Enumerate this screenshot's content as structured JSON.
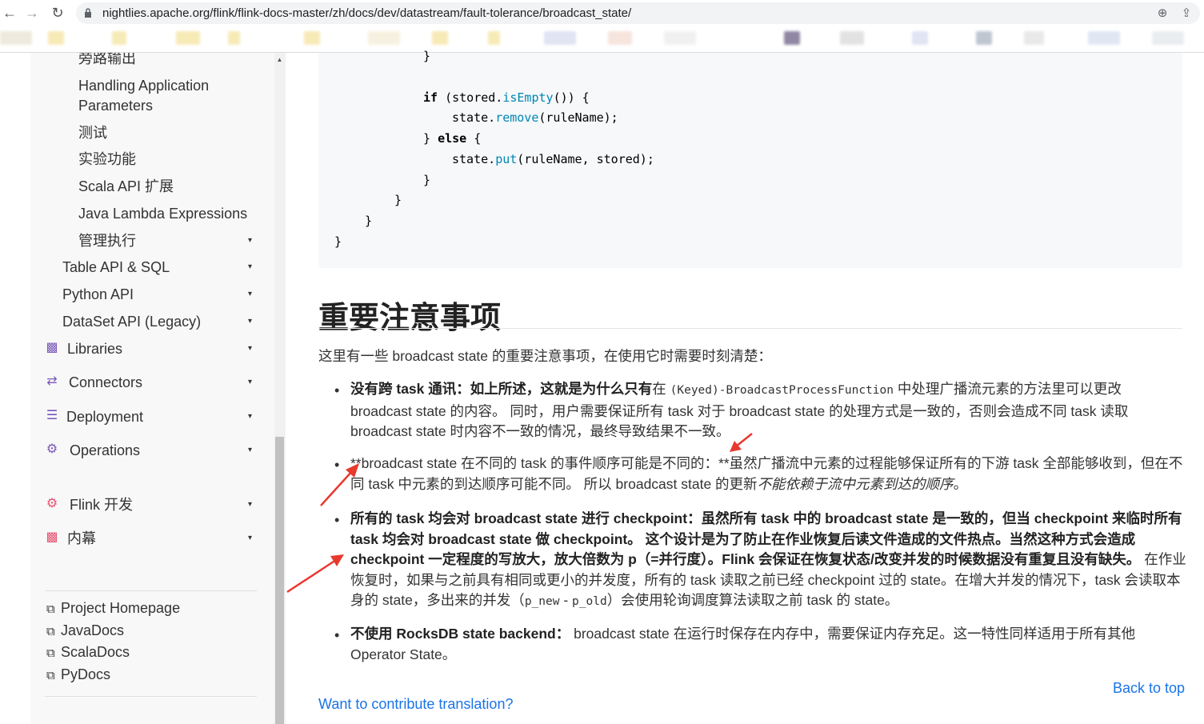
{
  "browser": {
    "url": "nightlies.apache.org/flink/flink-docs-master/zh/docs/dev/datastream/fault-tolerance/broadcast_state/",
    "back_icon": "←",
    "forward_icon": "→",
    "reload_icon": "↻",
    "zoom_icon": "⊕",
    "share_icon": "⇪"
  },
  "sidebar": {
    "top_items": [
      "旁路输出",
      "Handling Application",
      "Parameters",
      "测试",
      "实验功能",
      "Scala API 扩展",
      "Java Lambda Expressions",
      "管理执行"
    ],
    "sub_sections": [
      "Table API & SQL",
      "Python API",
      "DataSet API (Legacy)"
    ],
    "sections": [
      {
        "label": "Libraries",
        "icon": "book-icon"
      },
      {
        "label": "Connectors",
        "icon": "shuffle-icon"
      },
      {
        "label": "Deployment",
        "icon": "sliders-icon"
      },
      {
        "label": "Operations",
        "icon": "cogs-icon"
      },
      {
        "label": "Flink 开发",
        "icon": "cogs-icon"
      },
      {
        "label": "内幕",
        "icon": "book-icon"
      }
    ],
    "caret": "▾",
    "external_links": [
      "Project Homepage",
      "JavaDocs",
      "ScalaDocs",
      "PyDocs"
    ]
  },
  "code": {
    "line1": "}",
    "line2_kw": "if",
    "line2_a": " (stored.",
    "line2_fn": "isEmpty",
    "line2_b": "()) {",
    "line3_a": "state.",
    "line3_fn": "remove",
    "line3_b": "(ruleName);",
    "line4_a": "} ",
    "line4_kw": "else",
    "line4_b": " {",
    "line5_a": "state.",
    "line5_fn": "put",
    "line5_b": "(ruleName, stored);",
    "line6": "}",
    "line7": "}",
    "line8": "}",
    "line9": "}"
  },
  "content": {
    "heading": "重要注意事项",
    "intro": "这里有一些 broadcast state 的重要注意事项，在使用它时需要时刻清楚：",
    "items": [
      {
        "bold": "没有跨 task 通讯：如上所述，这就是为什么只有",
        "t1": "在 ",
        "code": "(Keyed)-BroadcastProcessFunction",
        "t2": " 中处理广播流元素的方法里可以更改 broadcast state 的内容。 同时，用户需要保证所有 task 对于 broadcast state 的处理方式是一致的，否则会造成不同 task 读取 broadcast state 时内容不一致的情况，最终导致结果不一致。"
      },
      {
        "t1": "**broadcast state 在不同的 task 的事件顺序可能是不同的：**虽然广播流中元素的过程能够保证所有的下游 task 全部能够收到，但在不同 task 中元素的到达顺序可能不同。 所以 broadcast state 的更新",
        "italic": "不能依赖于流中元素到达的顺序",
        "t2": "。"
      },
      {
        "bold": "所有的 task 均会对 broadcast state 进行 checkpoint：虽然所有 task 中的 broadcast state 是一致的，但当 checkpoint 来临时所有 task 均会对 broadcast state 做 checkpoint。 这个设计是为了防止在作业恢复后读文件造成的文件热点。当然这种方式会造成 checkpoint 一定程度的写放大，放大倍数为 p（=并行度）。Flink 会保证在恢复状态/改变并发的时候数据没有重复且没有缺失。",
        "t1": " 在作业恢复时，如果与之前具有相同或更小的并发度，所有的 task 读取之前已经 checkpoint 过的 state。在增大并发的情况下，task 会读取本身的 state，多出来的并发（",
        "code": "p_new",
        "t_mid": " - ",
        "code2": "p_old",
        "t2": "）会使用轮询调度算法读取之前 task 的 state。"
      },
      {
        "bold": "不使用 RocksDB state backend：",
        "t1": " broadcast state 在运行时保存在内存中，需要保证内存充足。这一特性同样适用于所有其他 Operator State。"
      }
    ],
    "bullet": "•",
    "back_to_top": "Back to top",
    "contribute": "Want to contribute translation?"
  },
  "colors": {
    "accent_link": "#1a73e8",
    "sidebar_icon": "#7a58b8",
    "sidebar_icon_alt": "#e6526f",
    "annotation_arrow": "#e8392f"
  }
}
